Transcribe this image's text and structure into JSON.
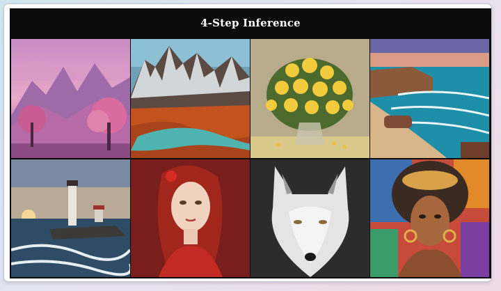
{
  "header": {
    "title": "4-Step Inference"
  },
  "images": [
    {
      "subject": "pink mountain landscape with blossom trees"
    },
    {
      "subject": "snowy mountains above a river valley in autumn"
    },
    {
      "subject": "bouquet of yellow roses in a glass vase"
    },
    {
      "subject": "turquoise sea waves on a sandy beach at sunset"
    },
    {
      "subject": "lighthouse on rocks in a stormy sea at sunset"
    },
    {
      "subject": "red-haired woman in red dress"
    },
    {
      "subject": "white wolf portrait"
    },
    {
      "subject": "colorful painted portrait of a young woman"
    }
  ],
  "colors": {
    "page_bg_start": "#cfe6ee",
    "page_bg_end": "#f0d9e6",
    "panel_bg": "#0b0b0b",
    "title_text": "#ffffff"
  }
}
